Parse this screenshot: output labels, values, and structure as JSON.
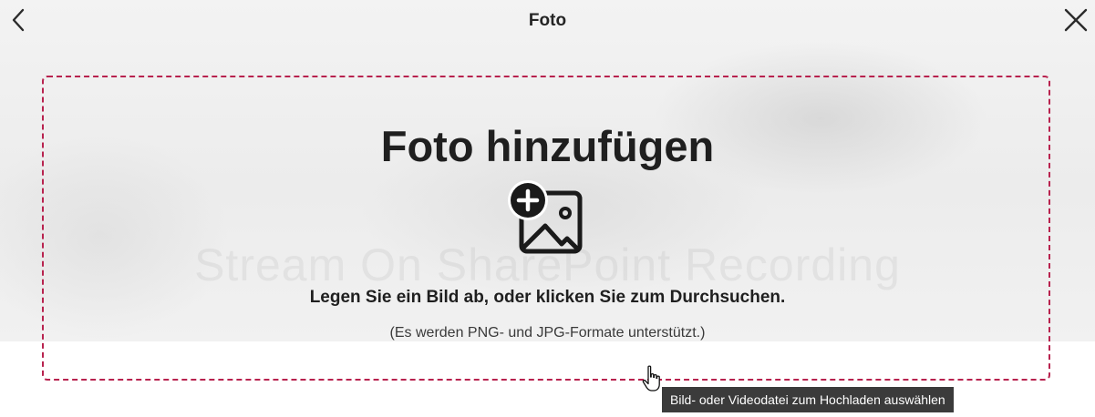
{
  "header": {
    "title": "Foto",
    "back_icon": "chevron-left-icon",
    "close_icon": "close-icon"
  },
  "background": {
    "ghost_text": "Stream On SharePoint Recording"
  },
  "dropzone": {
    "title": "Foto hinzufügen",
    "icon": "add-image-icon",
    "instruction": "Legen Sie ein Bild ab, oder klicken Sie zum Durchsuchen.",
    "formats_note": "(Es werden PNG- und JPG-Formate unterstützt.)",
    "border_color": "#b8224e"
  },
  "tooltip": {
    "text": "Bild- oder Videodatei zum Hochladen auswählen"
  },
  "cursor": {
    "icon": "hand-pointer-icon"
  }
}
